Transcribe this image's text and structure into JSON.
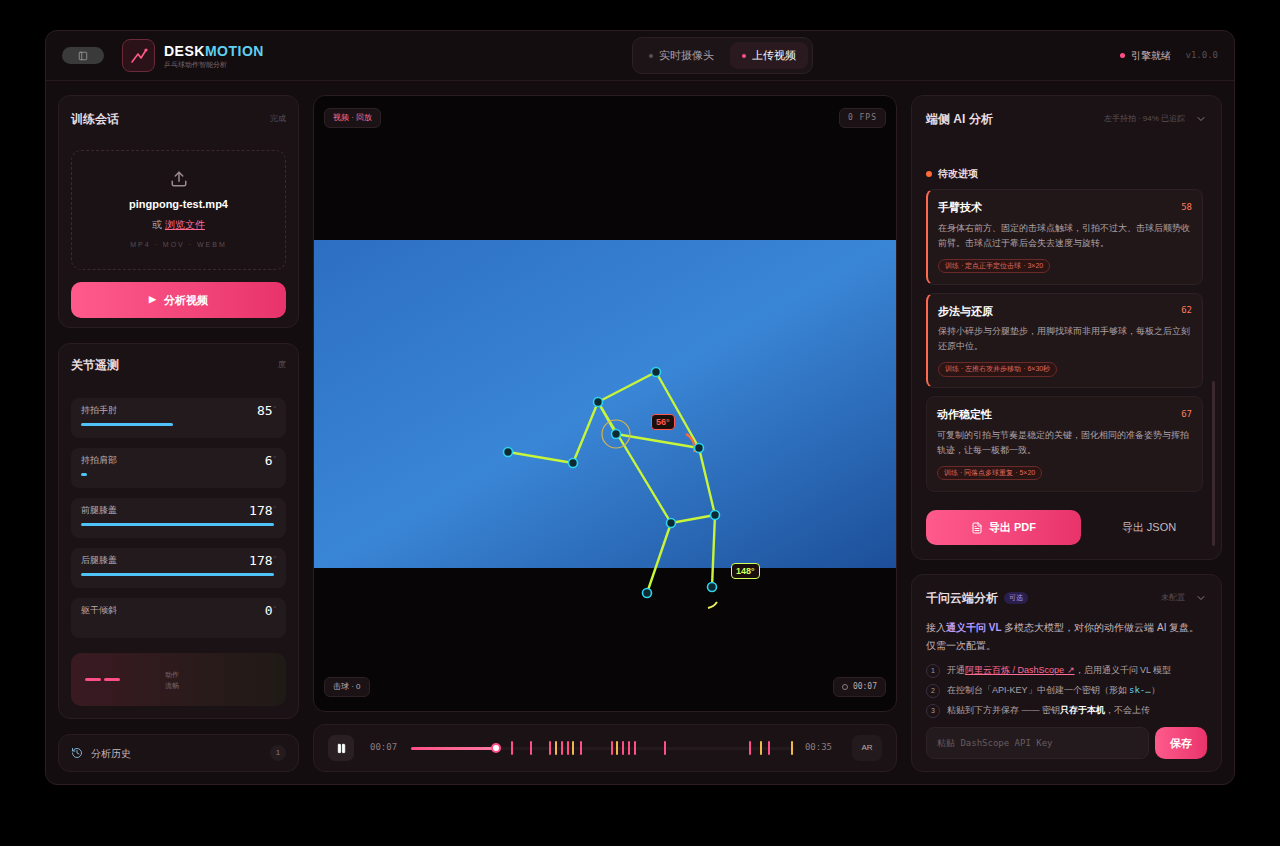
{
  "app": {
    "brand_prefix": "DESK",
    "brand_suffix": "MOTION",
    "subtitle": "乒乓球动作智能分析"
  },
  "mode_tabs": [
    {
      "label": "实时摄像头",
      "selected": false
    },
    {
      "label": "上传视频",
      "selected": true
    }
  ],
  "engine_status": {
    "label": "引擎就绪",
    "ready": true
  },
  "version": "v1.0.0",
  "session": {
    "title": "训练会话",
    "status": "完成",
    "file_name": "pingpong-test.mp4",
    "or_text": "或",
    "browse_link": "浏览文件",
    "formats": "MP4 · MOV · WEBM",
    "analyze_icon": "▶",
    "analyze_button": "分析视频"
  },
  "telemetry": {
    "title": "关节遥测",
    "unit_label": "度",
    "rows": [
      {
        "name": "持拍手肘",
        "value": "85",
        "unit": "°",
        "level": 0.47
      },
      {
        "name": "持拍肩部",
        "value": "6",
        "unit": "°",
        "level": 0.03
      },
      {
        "name": "前腿膝盖",
        "value": "178",
        "unit": "°",
        "level": 0.99
      },
      {
        "name": "后腿膝盖",
        "value": "178",
        "unit": "°",
        "level": 0.99
      },
      {
        "name": "躯干倾斜",
        "value": "0",
        "unit": "°",
        "level": 0
      }
    ],
    "summary": {
      "line1": "动作",
      "line2": "流畅"
    }
  },
  "history": {
    "label": "分析历史",
    "count": "1"
  },
  "video": {
    "source_tag": "视频 · 回放",
    "fps": "0 FPS",
    "hits": "击球 · 0",
    "timestamp": "00:07",
    "angles": [
      {
        "text": "56°",
        "color": "#ff5a4f"
      },
      {
        "text": "148°",
        "color": "#d4ff5a"
      }
    ]
  },
  "transport": {
    "playing": true,
    "current": "00:07",
    "duration": "00:35",
    "level": 0.22,
    "ar": "AR",
    "markers": [
      {
        "at": 0.26,
        "color": "#ff4f86"
      },
      {
        "at": 0.31,
        "color": "#ff4f86"
      },
      {
        "at": 0.36,
        "color": "#ff4f86"
      },
      {
        "at": 0.375,
        "color": "#f2b84b"
      },
      {
        "at": 0.39,
        "color": "#ff4f86"
      },
      {
        "at": 0.405,
        "color": "#ff4f86"
      },
      {
        "at": 0.42,
        "color": "#f2b84b"
      },
      {
        "at": 0.44,
        "color": "#ff4f86"
      },
      {
        "at": 0.52,
        "color": "#ff4f86"
      },
      {
        "at": 0.535,
        "color": "#f2b84b"
      },
      {
        "at": 0.55,
        "color": "#ff4f86"
      },
      {
        "at": 0.565,
        "color": "#ff4f86"
      },
      {
        "at": 0.58,
        "color": "#ff4f86"
      },
      {
        "at": 0.66,
        "color": "#ff4f86"
      },
      {
        "at": 0.88,
        "color": "#ff4f86"
      },
      {
        "at": 0.91,
        "color": "#f2b84b"
      },
      {
        "at": 0.93,
        "color": "#ff4f86"
      },
      {
        "at": 0.99,
        "color": "#f2b84b"
      }
    ]
  },
  "ai": {
    "title": "端侧 AI 分析",
    "meta": "左手持拍 · 94% 已追踪",
    "section": "待改进项",
    "items": [
      {
        "title": "手臂技术",
        "score": "58",
        "flagged": true,
        "description": "在身体右前方、固定的击球点触球，引拍不过大、击球后顺势收前臂。击球点过于靠后会失去速度与旋转。",
        "drill": "训练 · 定点正手定位击球 · 3×20"
      },
      {
        "title": "步法与还原",
        "score": "62",
        "flagged": true,
        "description": "保持小碎步与分腿垫步，用脚找球而非用手够球，每板之后立刻还原中位。",
        "drill": "训练 · 左推右攻并步移动 · 6×30秒"
      },
      {
        "title": "动作稳定性",
        "score": "67",
        "flagged": false,
        "description": "可复制的引拍与节奏是稳定的关键，固化相同的准备姿势与挥拍轨迹，让每一板都一致。",
        "drill": "训练 · 同落点多球重复 · 5×20"
      }
    ],
    "export_pdf": "导出 PDF",
    "export_json": "导出 JSON"
  },
  "qwen": {
    "title": "千问云端分析",
    "badge": "可选",
    "status": "未配置",
    "intro": [
      {
        "text": "接入",
        "highlight": false
      },
      {
        "text": "通义千问 VL",
        "highlight": true
      },
      {
        "text": " 多模态大模型，对你的动作做云端 AI 复盘。仅需一次配置。",
        "highlight": false
      }
    ],
    "steps": [
      {
        "number": "1",
        "parts": [
          {
            "text": "开通",
            "style": "plain"
          },
          {
            "text": "阿里云百炼 / DashScope ↗",
            "style": "link"
          },
          {
            "text": "，启用通义千问 VL 模型",
            "style": "plain"
          }
        ]
      },
      {
        "number": "2",
        "parts": [
          {
            "text": "在控制台「API-KEY」中创建一个密钥（形如 ",
            "style": "plain"
          },
          {
            "text": "sk-…",
            "style": "code"
          },
          {
            "text": "）",
            "style": "plain"
          }
        ]
      },
      {
        "number": "3",
        "parts": [
          {
            "text": "粘贴到下方并保存 —— 密钥",
            "style": "plain"
          },
          {
            "text": "只存于本机",
            "style": "bold"
          },
          {
            "text": "，不会上传",
            "style": "plain"
          }
        ]
      }
    ],
    "placeholder": "粘贴 DashScope API Key",
    "save_button": "保存"
  }
}
